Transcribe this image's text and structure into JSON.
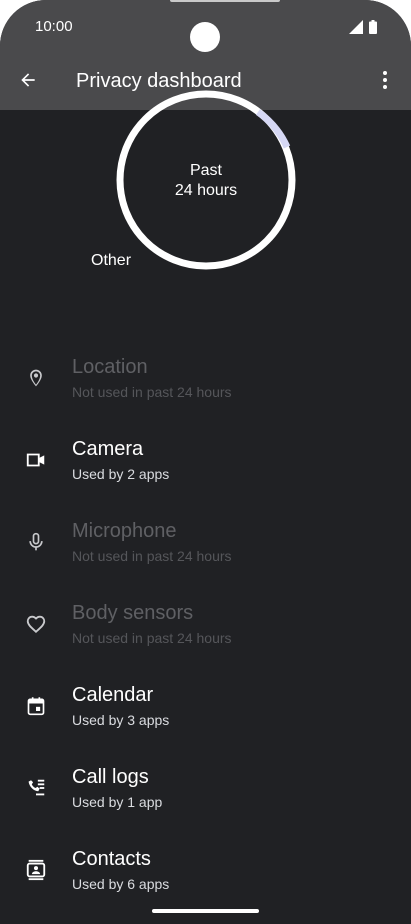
{
  "status_bar": {
    "time": "10:00",
    "icons": [
      "signal-icon",
      "battery-icon"
    ]
  },
  "app_bar": {
    "title": "Privacy dashboard",
    "back_icon": "arrow-back-icon",
    "overflow_icon": "more-vert-icon"
  },
  "usage_chart": {
    "center_line1": "Past",
    "center_line2": "24 hours",
    "other_label": "Other",
    "colors": {
      "ring": "#ffffff",
      "highlight": "#d6d8f5"
    }
  },
  "permissions": [
    {
      "title": "Location",
      "subtitle": "Not used in past 24 hours",
      "icon": "location-pin-icon",
      "enabled": false
    },
    {
      "title": "Camera",
      "subtitle": "Used by 2 apps",
      "icon": "videocam-icon",
      "enabled": true
    },
    {
      "title": "Microphone",
      "subtitle": "Not used in past 24 hours",
      "icon": "mic-icon",
      "enabled": false
    },
    {
      "title": "Body sensors",
      "subtitle": "Not used in past 24 hours",
      "icon": "heart-icon",
      "enabled": false
    },
    {
      "title": "Calendar",
      "subtitle": "Used by 3 apps",
      "icon": "calendar-icon",
      "enabled": true
    },
    {
      "title": "Call logs",
      "subtitle": "Used by 1 app",
      "icon": "call-log-icon",
      "enabled": true
    },
    {
      "title": "Contacts",
      "subtitle": "Used by 6 apps",
      "icon": "contacts-icon",
      "enabled": true
    }
  ],
  "theme": {
    "background": "#202124",
    "app_bar": "#4a4a4c",
    "text_primary": "#ffffff",
    "text_disabled": "#5f6064"
  }
}
